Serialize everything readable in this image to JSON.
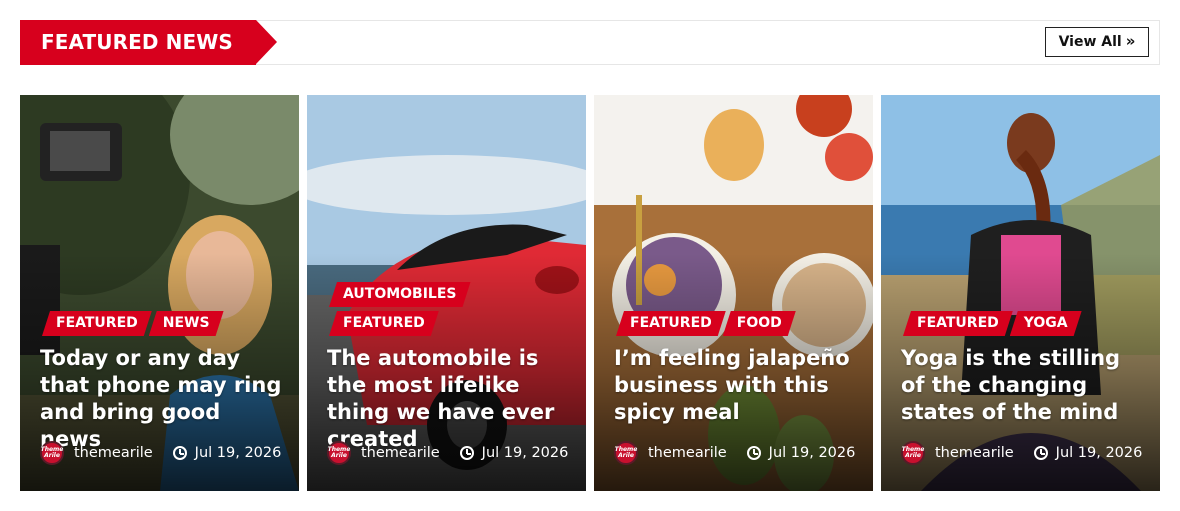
{
  "section": {
    "title": "FEATURED NEWS",
    "view_all": "View All",
    "view_all_icon": "»"
  },
  "colors": {
    "accent": "#d7001d"
  },
  "cards": [
    {
      "categories": [
        "FEATURED",
        "NEWS"
      ],
      "title": "Today or any day that phone may ring and bring good news",
      "author": "themearile",
      "date": "Jul 19, 2026",
      "avatar_text": "Theme Arile"
    },
    {
      "category_top": "AUTOMOBILES",
      "categories": [
        "FEATURED"
      ],
      "title": "The automobile is the most lifelike thing we have ever created",
      "author": "themearile",
      "date": "Jul 19, 2026",
      "avatar_text": "Theme Arile"
    },
    {
      "categories": [
        "FEATURED",
        "FOOD"
      ],
      "title": "I’m feeling jalapeño business with this spicy meal",
      "author": "themearile",
      "date": "Jul 19, 2026",
      "avatar_text": "Theme Arile"
    },
    {
      "categories": [
        "FEATURED",
        "YOGA"
      ],
      "title": "Yoga is the stilling of the changing states of the mind",
      "author": "themearile",
      "date": "Jul 19, 2026",
      "avatar_text": "Theme Arile"
    }
  ]
}
